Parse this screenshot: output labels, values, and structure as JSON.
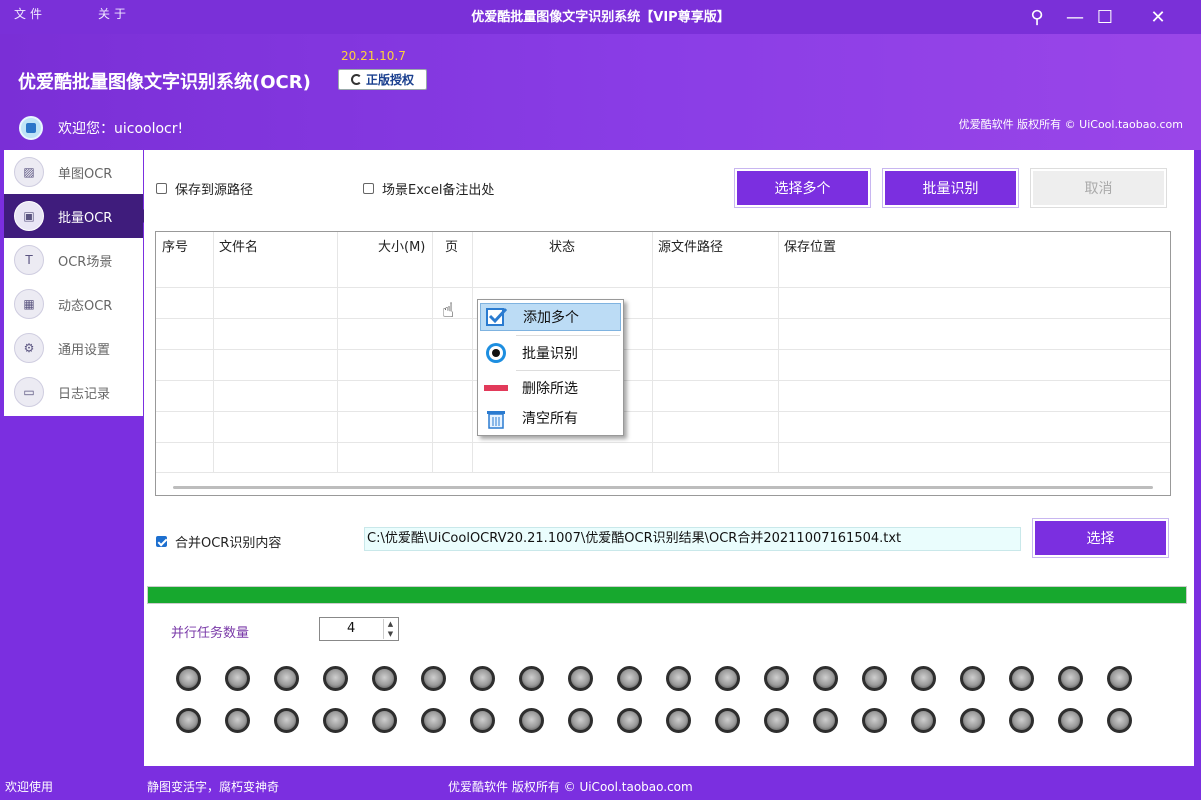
{
  "titlebar": {
    "menu": [
      "文件",
      "关于"
    ],
    "title": "优爱酷批量图像文字识别系统【VIP尊享版】",
    "pin_label": "⚲",
    "minimize_label": "—",
    "maximize_label": "☐",
    "close_label": "✕"
  },
  "header": {
    "app_name": "优爱酷批量图像文字识别系统(OCR)",
    "version": "20.21.10.7",
    "license_label": "正版授权",
    "welcome": "欢迎您：uicoolocr!",
    "copyright": "优爱酷软件 版权所有 © UiCool.taobao.com"
  },
  "sidebar": {
    "items": [
      {
        "label": "单图OCR",
        "icon": "image-icon"
      },
      {
        "label": "批量OCR",
        "icon": "images-icon"
      },
      {
        "label": "OCR场景",
        "icon": "text-icon"
      },
      {
        "label": "动态OCR",
        "icon": "motion-image-icon"
      },
      {
        "label": "通用设置",
        "icon": "settings-icon"
      },
      {
        "label": "日志记录",
        "icon": "folder-icon"
      }
    ],
    "active_index": 1
  },
  "options": {
    "save_to_source": {
      "label": "保存到源路径",
      "checked": false
    },
    "scene_excel_note": {
      "label": "场景Excel备注出处",
      "checked": false
    }
  },
  "toolbar": {
    "select_multiple": "选择多个",
    "batch_recognize": "批量识别",
    "cancel": "取消"
  },
  "table": {
    "columns": [
      "序号",
      "文件名",
      "大小(M)",
      "页",
      "状态",
      "源文件路径",
      "保存位置"
    ]
  },
  "context_menu": {
    "items": [
      {
        "label": "添加多个",
        "icon": "checkbox-icon"
      },
      {
        "label": "批量识别",
        "icon": "record-icon"
      },
      {
        "label": "删除所选",
        "icon": "delete-icon"
      },
      {
        "label": "清空所有",
        "icon": "trash-icon"
      }
    ]
  },
  "merge": {
    "label": "合并OCR识别内容",
    "checked": true,
    "path": "C:\\优爱酷\\UiCoolOCRV20.21.1007\\优爱酷OCR识别结果\\OCR合并20211007161504.txt",
    "choose_label": "选择"
  },
  "progress": {
    "value": 100
  },
  "parallel": {
    "label": "并行任务数量",
    "value": "4"
  },
  "status_lights": {
    "rows": 2,
    "per_row": 20
  },
  "statusbar": {
    "left": "欢迎使用",
    "slogan": "静图变活字，腐朽变神奇",
    "copyright": "优爱酷软件 版权所有 ©  UiCool.taobao.com"
  },
  "colors": {
    "accent": "#7b2fe0",
    "sidebar_active": "#3f1c7c",
    "progress": "#17a82e"
  }
}
